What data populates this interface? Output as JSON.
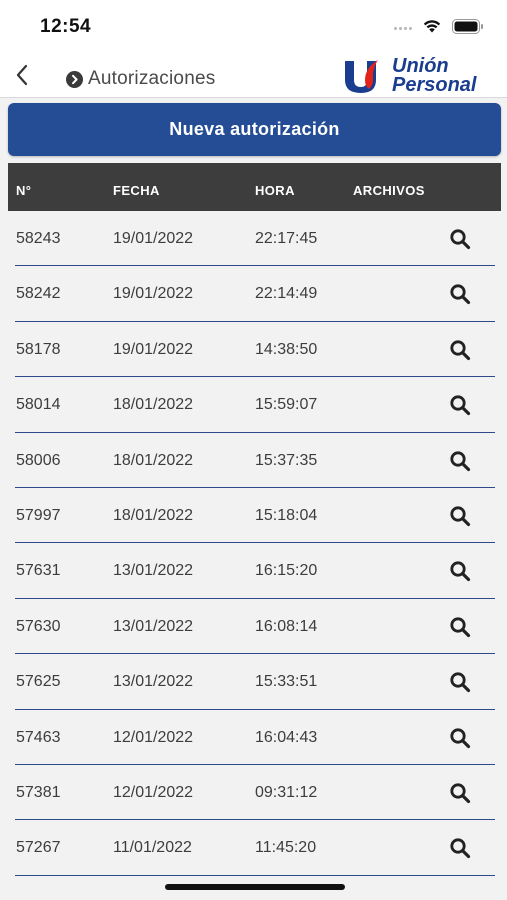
{
  "status": {
    "time": "12:54"
  },
  "nav": {
    "title": "Autorizaciones",
    "brand_line1": "Unión",
    "brand_line2": "Personal"
  },
  "actions": {
    "new_authorization": "Nueva autorización"
  },
  "table": {
    "headers": {
      "num": "N°",
      "fecha": "FECHA",
      "hora": "HORA",
      "archivos": "ARCHIVOS"
    },
    "rows": [
      {
        "num": "58243",
        "fecha": "19/01/2022",
        "hora": "22:17:45"
      },
      {
        "num": "58242",
        "fecha": "19/01/2022",
        "hora": "22:14:49"
      },
      {
        "num": "58178",
        "fecha": "19/01/2022",
        "hora": "14:38:50"
      },
      {
        "num": "58014",
        "fecha": "18/01/2022",
        "hora": "15:59:07"
      },
      {
        "num": "58006",
        "fecha": "18/01/2022",
        "hora": "15:37:35"
      },
      {
        "num": "57997",
        "fecha": "18/01/2022",
        "hora": "15:18:04"
      },
      {
        "num": "57631",
        "fecha": "13/01/2022",
        "hora": "16:15:20"
      },
      {
        "num": "57630",
        "fecha": "13/01/2022",
        "hora": "16:08:14"
      },
      {
        "num": "57625",
        "fecha": "13/01/2022",
        "hora": "15:33:51"
      },
      {
        "num": "57463",
        "fecha": "12/01/2022",
        "hora": "16:04:43"
      },
      {
        "num": "57381",
        "fecha": "12/01/2022",
        "hora": "09:31:12"
      },
      {
        "num": "57267",
        "fecha": "11/01/2022",
        "hora": "11:45:20"
      }
    ]
  },
  "colors": {
    "primary": "#244d95",
    "header_bg": "#3d3d3d",
    "row_divider": "#2d4a8c",
    "brand_blue": "#1a3d8f",
    "brand_red": "#e2231a"
  },
  "icons": {
    "back": "chevron-left-icon",
    "title": "circle-chevron-right-icon",
    "row_action": "search-icon"
  }
}
